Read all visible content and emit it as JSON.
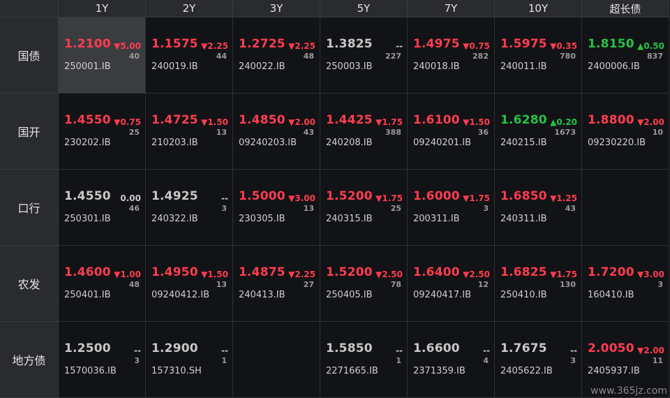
{
  "columns": [
    "1Y",
    "2Y",
    "3Y",
    "5Y",
    "7Y",
    "10Y",
    "超长债"
  ],
  "rows": [
    {
      "label": "国债",
      "cells": [
        {
          "yield": "1.2100",
          "change": "▼5.00",
          "count": "40",
          "code": "250001.IB",
          "color": "red",
          "selected": true
        },
        {
          "yield": "1.1575",
          "change": "▼2.25",
          "count": "44",
          "code": "240019.IB",
          "color": "red"
        },
        {
          "yield": "1.2725",
          "change": "▼2.25",
          "count": "48",
          "code": "240022.IB",
          "color": "red"
        },
        {
          "yield": "1.3825",
          "change": "--",
          "count": "227",
          "code": "250003.IB",
          "color": "grey"
        },
        {
          "yield": "1.4975",
          "change": "▼0.75",
          "count": "282",
          "code": "240018.IB",
          "color": "red"
        },
        {
          "yield": "1.5975",
          "change": "▼0.35",
          "count": "780",
          "code": "240011.IB",
          "color": "red"
        },
        {
          "yield": "1.8150",
          "change": "▲0.50",
          "count": "837",
          "code": "2400006.IB",
          "color": "green"
        }
      ]
    },
    {
      "label": "国开",
      "cells": [
        {
          "yield": "1.4550",
          "change": "▼0.75",
          "count": "25",
          "code": "230202.IB",
          "color": "red"
        },
        {
          "yield": "1.4725",
          "change": "▼1.50",
          "count": "13",
          "code": "210203.IB",
          "color": "red"
        },
        {
          "yield": "1.4850",
          "change": "▼2.00",
          "count": "43",
          "code": "09240203.IB",
          "color": "red"
        },
        {
          "yield": "1.4425",
          "change": "▼1.75",
          "count": "388",
          "code": "240208.IB",
          "color": "red"
        },
        {
          "yield": "1.6100",
          "change": "▼1.50",
          "count": "36",
          "code": "09240201.IB",
          "color": "red"
        },
        {
          "yield": "1.6280",
          "change": "▲0.20",
          "count": "1673",
          "code": "240215.IB",
          "color": "green"
        },
        {
          "yield": "1.8800",
          "change": "▼2.00",
          "count": "10",
          "code": "09230220.IB",
          "color": "red"
        }
      ]
    },
    {
      "label": "口行",
      "cells": [
        {
          "yield": "1.4550",
          "change": "0.00",
          "count": "46",
          "code": "250301.IB",
          "color": "grey"
        },
        {
          "yield": "1.4925",
          "change": "--",
          "count": "3",
          "code": "240322.IB",
          "color": "grey"
        },
        {
          "yield": "1.5000",
          "change": "▼3.00",
          "count": "13",
          "code": "230305.IB",
          "color": "red"
        },
        {
          "yield": "1.5200",
          "change": "▼1.75",
          "count": "25",
          "code": "240315.IB",
          "color": "red"
        },
        {
          "yield": "1.6000",
          "change": "▼1.75",
          "count": "3",
          "code": "200311.IB",
          "color": "red"
        },
        {
          "yield": "1.6850",
          "change": "▼1.25",
          "count": "43",
          "code": "240311.IB",
          "color": "red"
        },
        {
          "empty": true
        }
      ]
    },
    {
      "label": "农发",
      "cells": [
        {
          "yield": "1.4600",
          "change": "▼1.00",
          "count": "48",
          "code": "250401.IB",
          "color": "red"
        },
        {
          "yield": "1.4950",
          "change": "▼1.50",
          "count": "13",
          "code": "09240412.IB",
          "color": "red"
        },
        {
          "yield": "1.4875",
          "change": "▼2.25",
          "count": "27",
          "code": "240413.IB",
          "color": "red"
        },
        {
          "yield": "1.5200",
          "change": "▼2.50",
          "count": "78",
          "code": "250405.IB",
          "color": "red"
        },
        {
          "yield": "1.6400",
          "change": "▼2.50",
          "count": "12",
          "code": "09240417.IB",
          "color": "red"
        },
        {
          "yield": "1.6825",
          "change": "▼1.75",
          "count": "130",
          "code": "250410.IB",
          "color": "red"
        },
        {
          "yield": "1.7200",
          "change": "▼3.00",
          "count": "3",
          "code": "160410.IB",
          "color": "red"
        }
      ]
    },
    {
      "label": "地方债",
      "cells": [
        {
          "yield": "1.2500",
          "change": "--",
          "count": "3",
          "code": "1570036.IB",
          "color": "grey"
        },
        {
          "yield": "1.2900",
          "change": "--",
          "count": "1",
          "code": "157310.SH",
          "color": "grey"
        },
        {
          "empty": true
        },
        {
          "yield": "1.5850",
          "change": "--",
          "count": "1",
          "code": "2271665.IB",
          "color": "grey"
        },
        {
          "yield": "1.6600",
          "change": "--",
          "count": "4",
          "code": "2371359.IB",
          "color": "grey"
        },
        {
          "yield": "1.7675",
          "change": "--",
          "count": "3",
          "code": "2405622.IB",
          "color": "grey"
        },
        {
          "yield": "2.0050",
          "change": "▼2.00",
          "count": "11",
          "code": "2405937.IB",
          "color": "red"
        }
      ]
    }
  ],
  "watermark": "www.365jz.com",
  "colors": {
    "red": "#ff3d4f",
    "green": "#26c246",
    "grey": "#c8c8c8",
    "header_bg": "#2a2b2f",
    "cell_bg": "#121316",
    "selected_bg": "#3b3c40"
  }
}
